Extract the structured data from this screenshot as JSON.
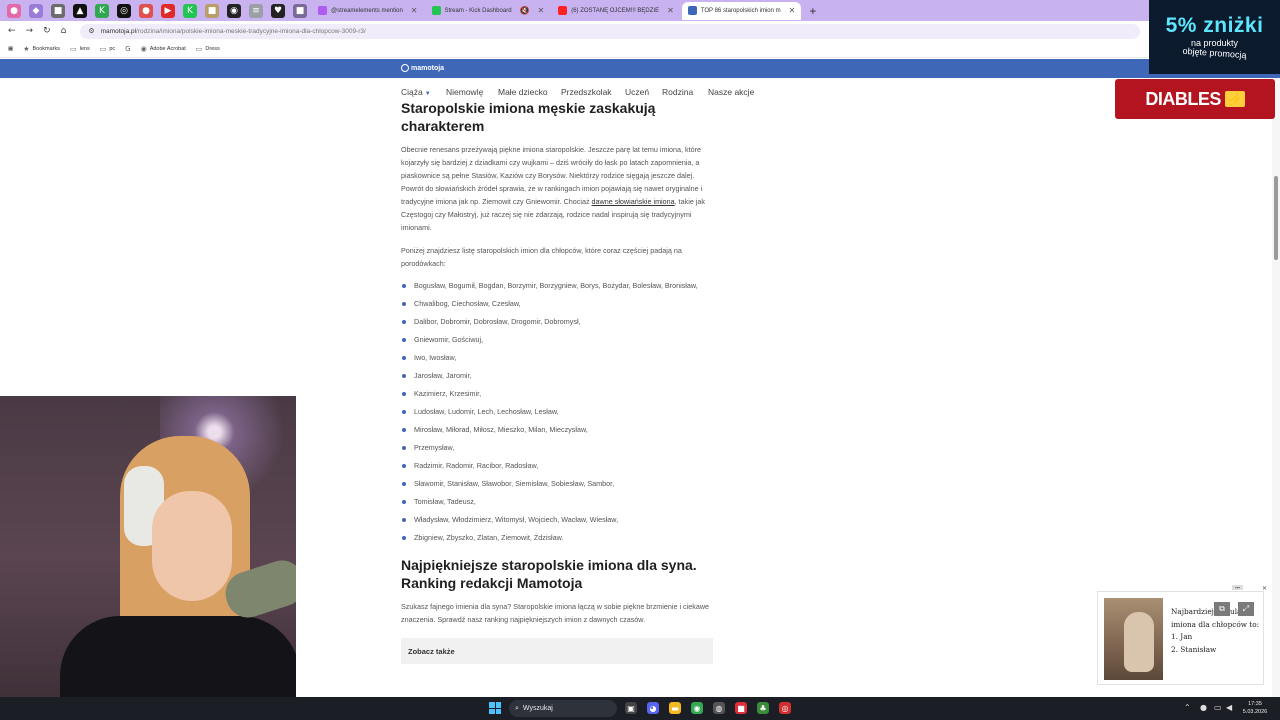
{
  "browser": {
    "tabs": [
      {
        "label": "@streamelements mention",
        "color": "#b15cf0"
      },
      {
        "label": "Stream - Kick Dashboard",
        "color": "#23c552"
      },
      {
        "label": "(6) ZOSTANĘ OJCEM!!! BĘDZIE",
        "color": "#ff2020"
      },
      {
        "label": "TOP 86 staropolskich imion m",
        "color": "#3e67b8"
      }
    ],
    "active_tab_index": 3,
    "new_tab": "+",
    "url_host": "mamotoja.pl",
    "url_path": "/rodzina/imiona/polskie-imiona-meskie-tradycyjne-imiona-dla-chlopcow-3009-r3/",
    "bookmarks": [
      "Bookmarks",
      "lens",
      "pc",
      "Adobe Acrobat",
      "Dress"
    ]
  },
  "ads": {
    "promo_big": "5% zniżki",
    "promo_line1": "na produkty",
    "promo_line2": "objęte promocją",
    "diables": "DIABLES"
  },
  "site": {
    "logo": "mamotoja",
    "nav": [
      "Ciąża",
      "Niemowlę",
      "Małe dziecko",
      "Przedszkolak",
      "Uczeń",
      "Rodzina",
      "Nasze akcje"
    ]
  },
  "article": {
    "heading1": "Staropolskie imiona męskie zaskakują charakterem",
    "para1_a": "Obecnie renesans przeżywają piękne imiona staropolskie. Jeszcze parę lat temu imiona, które kojarzyły się bardziej z dziadkami czy wujkami – dziś wróciły do łask po latach zapomnienia, a piaskownice są pełne Stasiów, Kaziów czy Borysów. Niektórzy rodzice sięgają jeszcze dalej. Powrót do słowiańskich źródeł sprawia, że w rankingach imion pojawiają się nawet oryginalne i tradycyjne imiona jak np. Ziemowit czy Gniewomir. Chociaż ",
    "para1_link": "dawne słowiańskie imiona",
    "para1_b": ", takie jak Częstogoj czy Małostryj, już raczej się nie zdarzają, rodzice nadal inspirują się tradycyjnymi imionami.",
    "para2": "Poniżej znajdziesz listę staropolskich imion dla chłopców, które coraz częściej padają na porodówkach:",
    "names": [
      "Bogusław, Bogumił, Bogdan, Borzymir, Borzygniew, Borys, Bożydar, Bolesław, Bronisław,",
      "Chwalibog, Ciechosław, Czesław,",
      "Dalibor, Dobromir, Dobrosław, Drogomir, Dobromysł,",
      "Gniewomir, Gościwuj,",
      "Iwo, Iwosław,",
      "Jarosław, Jaromir,",
      "Kazimierz, Krzesimir,",
      "Ludosław, Ludomir, Lech, Lechosław, Lesław,",
      "Mirosław, Miłorad, Miłosz, Mieszko, Milan, Mieczysław,",
      "Przemysław,",
      "Radzimir, Radomir, Racibor, Radosław,",
      "Sławomir, Stanisław, Sławobor, Siemisław, Sobiesław, Sambor,",
      "Tomisław, Tadeusz,",
      "Władysław, Włodzimierz, Witomysł, Wojciech, Wacław, Wiesław,",
      "Zbigniew, Zbyszko, Zlatan, Ziemowit, Żdzisław."
    ],
    "heading2": "Najpiękniejsze staropolskie imiona dla syna. Ranking redakcji Mamotoja",
    "para3": "Szukasz fajnego imienia dla syna? Staropolskie imiona łączą w sobie piękne brzmienie i ciekawe znaczenia. Sprawdź nasz ranking najpiękniejszych imion z dawnych czasów.",
    "see_also": "Zobacz także"
  },
  "recommendation": {
    "line1": "Najbardziej popularne",
    "line2": "imiona dla chłopców to:",
    "line3": "1. Jan",
    "line4": "2. Stanisław"
  },
  "taskbar": {
    "search_label": "Wyszukaj",
    "time": "17:35",
    "date": "5.03.2026"
  }
}
